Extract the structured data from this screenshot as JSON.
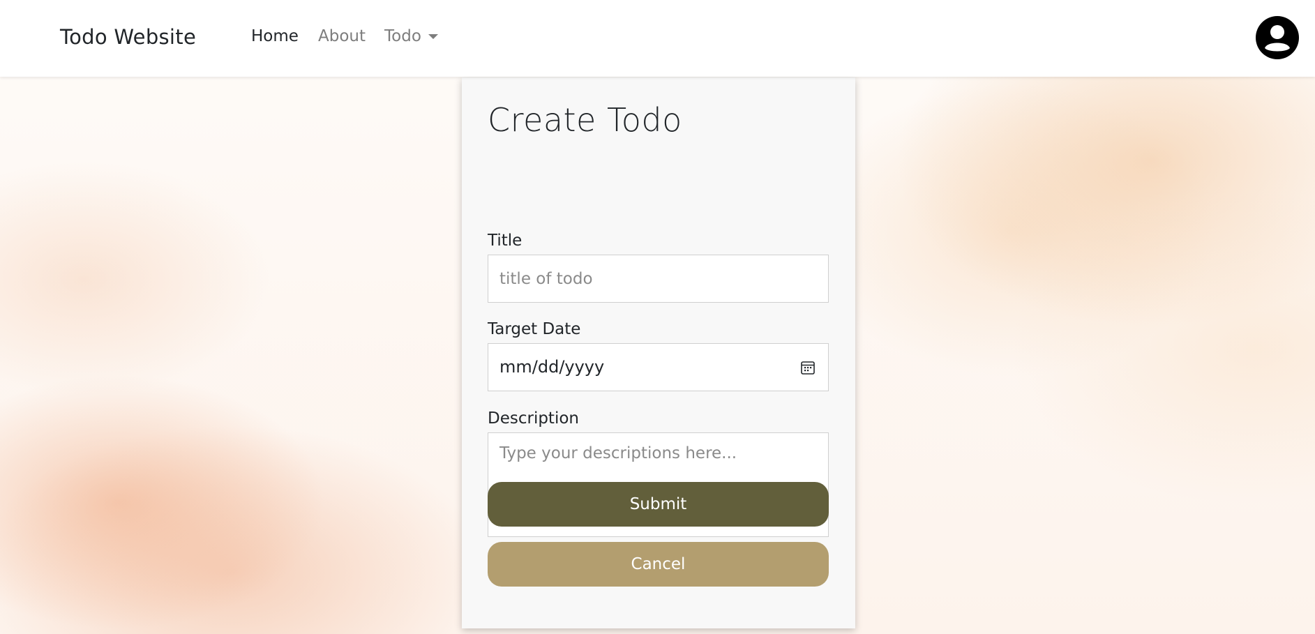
{
  "navbar": {
    "brand": "Todo Website",
    "links": {
      "home": "Home",
      "about": "About",
      "todo": "Todo"
    }
  },
  "form": {
    "title": "Create Todo",
    "fields": {
      "title_label": "Title",
      "title_placeholder": "title of todo",
      "date_label": "Target Date",
      "date_value": "mm/dd/yyyy",
      "description_label": "Description",
      "description_placeholder": "Type your descriptions here..."
    },
    "buttons": {
      "submit": "Submit",
      "cancel": "Cancel"
    }
  },
  "icons": {
    "avatar": "user-avatar-icon",
    "calendar": "calendar-icon",
    "dropdown": "caret-down-icon"
  },
  "colors": {
    "submit": "#625f3b",
    "cancel": "#b39e6f",
    "card": "#f8f8f8"
  }
}
